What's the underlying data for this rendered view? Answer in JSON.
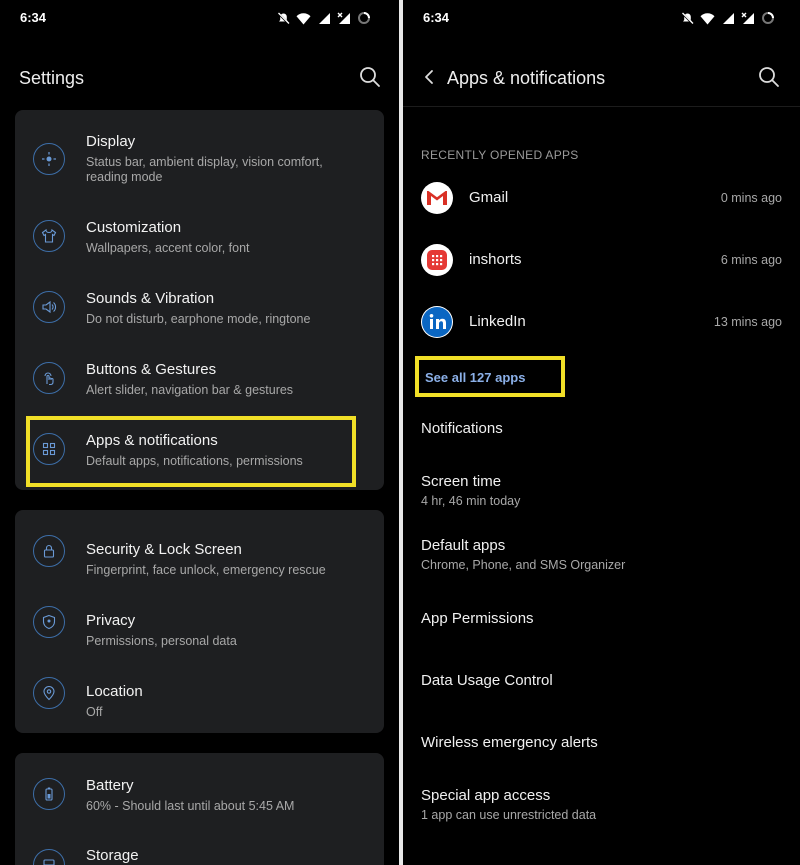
{
  "left": {
    "status": {
      "time": "6:34"
    },
    "appbar": {
      "title": "Settings"
    },
    "cards": [
      [
        {
          "icon": "display-icon",
          "title": "Display",
          "subtitle": "Status bar, ambient display, vision comfort, reading mode"
        },
        {
          "icon": "customization-icon",
          "title": "Customization",
          "subtitle": "Wallpapers, accent color, font"
        },
        {
          "icon": "sound-icon",
          "title": "Sounds & Vibration",
          "subtitle": "Do not disturb, earphone mode, ringtone"
        },
        {
          "icon": "gesture-icon",
          "title": "Buttons & Gestures",
          "subtitle": "Alert slider, navigation bar & gestures"
        },
        {
          "icon": "apps-icon",
          "title": "Apps & notifications",
          "subtitle": "Default apps, notifications, permissions"
        }
      ],
      [
        {
          "icon": "lock-icon",
          "title": "Security & Lock Screen",
          "subtitle": "Fingerprint, face unlock, emergency rescue"
        },
        {
          "icon": "privacy-icon",
          "title": "Privacy",
          "subtitle": "Permissions, personal data"
        },
        {
          "icon": "location-icon",
          "title": "Location",
          "subtitle": "Off"
        }
      ],
      [
        {
          "icon": "battery-icon",
          "title": "Battery",
          "subtitle": "60% - Should last until about 5:45 AM"
        },
        {
          "icon": "storage-icon",
          "title": "Storage",
          "subtitle": ""
        }
      ]
    ]
  },
  "right": {
    "status": {
      "time": "6:34"
    },
    "appbar": {
      "title": "Apps & notifications"
    },
    "recent_label": "RECENTLY OPENED APPS",
    "recent_apps": [
      {
        "name": "Gmail",
        "ago": "0 mins ago"
      },
      {
        "name": "inshorts",
        "ago": "6 mins ago"
      },
      {
        "name": "LinkedIn",
        "ago": "13 mins ago"
      }
    ],
    "see_all": "See all 127 apps",
    "items": [
      {
        "title": "Notifications",
        "subtitle": ""
      },
      {
        "title": "Screen time",
        "subtitle": "4 hr, 46 min today"
      },
      {
        "title": "Default apps",
        "subtitle": "Chrome, Phone, and SMS Organizer"
      },
      {
        "title": "App Permissions",
        "subtitle": ""
      },
      {
        "title": "Data Usage Control",
        "subtitle": ""
      },
      {
        "title": "Wireless emergency alerts",
        "subtitle": ""
      },
      {
        "title": "Special app access",
        "subtitle": "1 app can use unrestricted data"
      }
    ]
  },
  "colors": {
    "highlight": "#f1df27",
    "accent": "#3d6ea8",
    "link": "#8bb0e8",
    "card": "#1e1f21"
  }
}
